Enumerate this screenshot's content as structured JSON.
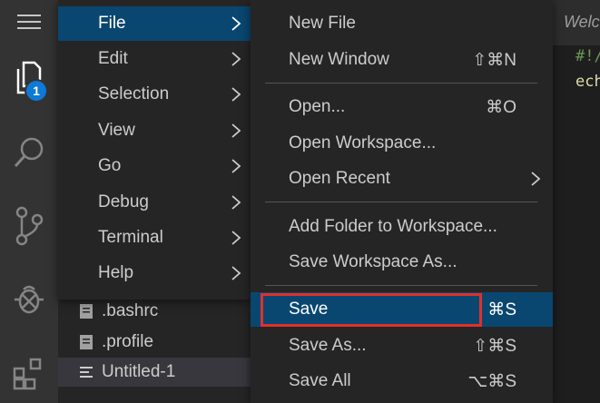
{
  "colors": {
    "activity_bar": "#333333",
    "menu_bg": "#252526",
    "selection": "#094771",
    "badge": "#0e79d6",
    "highlight_border": "#e0302b"
  },
  "activity_bar": {
    "items": [
      {
        "icon": "hamburger-menu-icon"
      },
      {
        "icon": "explorer-files-icon",
        "badge": "1"
      },
      {
        "icon": "search-icon"
      },
      {
        "icon": "source-control-icon"
      },
      {
        "icon": "debug-icon"
      },
      {
        "icon": "extensions-icon"
      }
    ]
  },
  "menubar": {
    "items": [
      {
        "label": "File",
        "active": true
      },
      {
        "label": "Edit"
      },
      {
        "label": "Selection"
      },
      {
        "label": "View"
      },
      {
        "label": "Go"
      },
      {
        "label": "Debug"
      },
      {
        "label": "Terminal"
      },
      {
        "label": "Help"
      }
    ]
  },
  "file_menu": {
    "items": [
      {
        "label": "New File",
        "shortcut": ""
      },
      {
        "label": "New Window",
        "shortcut": "⇧⌘N"
      },
      {
        "label": "Open...",
        "shortcut": "⌘O"
      },
      {
        "label": "Open Workspace...",
        "shortcut": ""
      },
      {
        "label": "Open Recent",
        "shortcut": ""
      },
      {
        "label": "Add Folder to Workspace...",
        "shortcut": ""
      },
      {
        "label": "Save Workspace As...",
        "shortcut": ""
      },
      {
        "label": "Save",
        "shortcut": "⌘S",
        "active": true
      },
      {
        "label": "Save As...",
        "shortcut": "⇧⌘S"
      },
      {
        "label": "Save All",
        "shortcut": "⌥⌘S"
      }
    ]
  },
  "explorer": {
    "files": [
      {
        "name": ".bashrc"
      },
      {
        "name": ".profile"
      },
      {
        "name": "Untitled-1",
        "selected": true
      }
    ]
  },
  "editor": {
    "tab_label": "Welcome",
    "code_lines": [
      "#!/",
      "ech"
    ]
  }
}
